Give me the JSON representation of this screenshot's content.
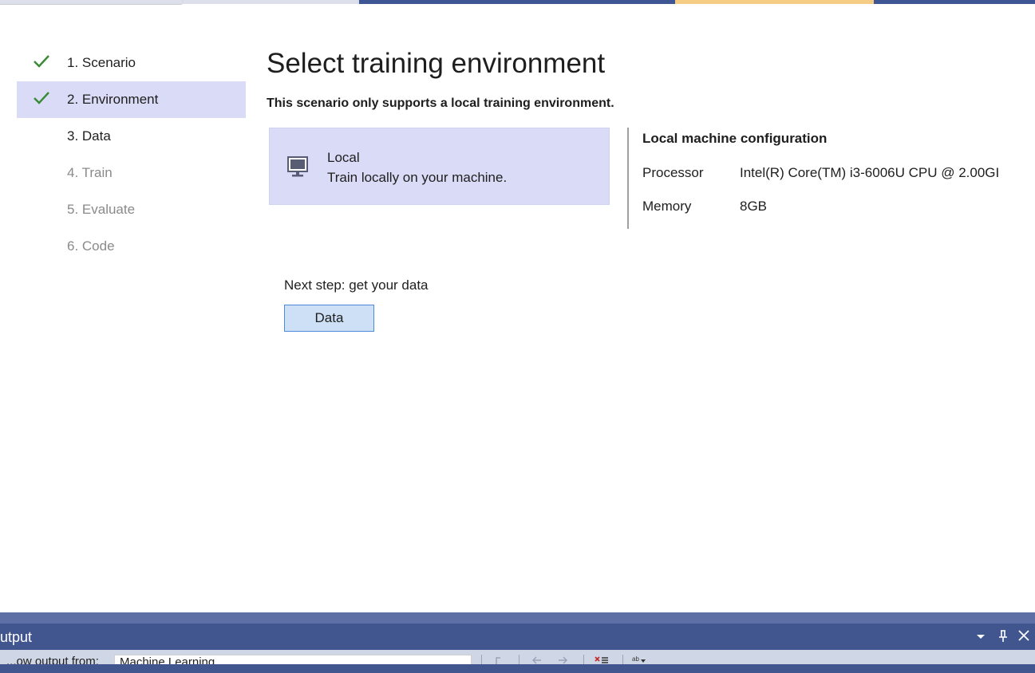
{
  "steps": [
    {
      "label": "1. Scenario",
      "state": "done",
      "icon": "check-icon"
    },
    {
      "label": "2. Environment",
      "state": "current",
      "icon": "check-icon"
    },
    {
      "label": "3. Data",
      "state": "enabled"
    },
    {
      "label": "4. Train",
      "state": "disabled"
    },
    {
      "label": "5. Evaluate",
      "state": "disabled"
    },
    {
      "label": "6. Code",
      "state": "disabled"
    }
  ],
  "main": {
    "title": "Select training environment",
    "subtitle": "This scenario only supports a local training environment."
  },
  "environment": {
    "icon": "monitor-icon",
    "name": "Local",
    "description": "Train locally on your machine."
  },
  "config": {
    "title": "Local machine configuration",
    "processor_label": "Processor",
    "processor_value": "Intel(R) Core(TM) i3-6006U CPU @ 2.00GI",
    "memory_label": "Memory",
    "memory_value": "8GB"
  },
  "next": {
    "text": "Next step: get your data",
    "button_label": "Data"
  },
  "output": {
    "title": "utput",
    "show_label": "...ow output from:",
    "source_value": "Machine Learning",
    "icons": [
      "dropdown-arrow-icon",
      "pin-icon",
      "close-icon",
      "go-to-previous-icon",
      "go-to-next-icon",
      "clear-all-icon",
      "word-wrap-icon"
    ]
  },
  "colors": {
    "accent_selected": "#dadcf7",
    "check_green": "#388a34",
    "tool_window_header": "#41568f",
    "tab_active": "#f5cc84",
    "button_bg": "#cde0f5",
    "button_border": "#4d8ad9"
  }
}
